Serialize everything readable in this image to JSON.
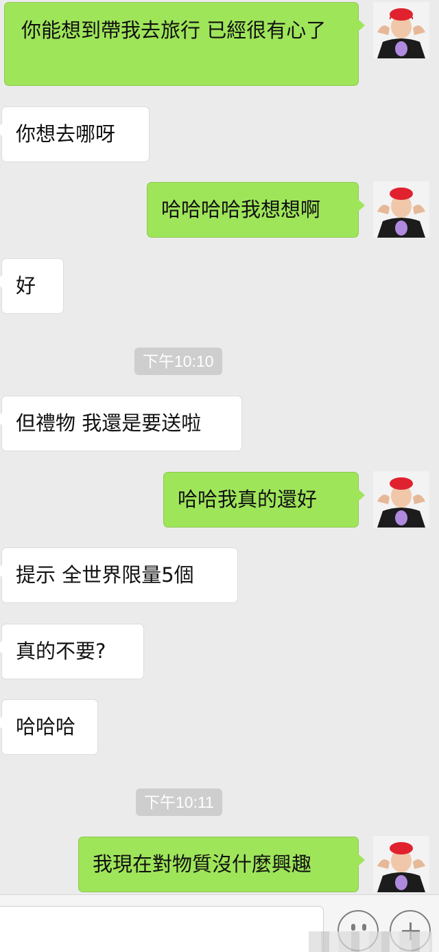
{
  "messages": [
    {
      "side": "out",
      "text": "你能想到帶我去旅行 已經很有心了"
    },
    {
      "side": "in",
      "text": "你想去哪呀"
    },
    {
      "side": "out",
      "text": "哈哈哈哈我想想啊"
    },
    {
      "side": "in",
      "text": "好"
    },
    {
      "side": "time",
      "text": "下午10:10"
    },
    {
      "side": "in",
      "text": "但禮物 我還是要送啦"
    },
    {
      "side": "out",
      "text": "哈哈我真的還好"
    },
    {
      "side": "in",
      "text": "提示 全世界限量5個"
    },
    {
      "side": "in",
      "text": "真的不要?"
    },
    {
      "side": "in",
      "text": "哈哈哈"
    },
    {
      "side": "time",
      "text": "下午10:11"
    },
    {
      "side": "out",
      "text": "我現在對物質沒什麼興趣"
    }
  ],
  "colors": {
    "outgoing_bubble": "#9fe55a",
    "incoming_bubble": "#ffffff",
    "background": "#ebebeb",
    "timestamp_bg": "#cecece"
  },
  "input_bar": {
    "icons": [
      "emoji-icon",
      "plus-icon"
    ]
  }
}
